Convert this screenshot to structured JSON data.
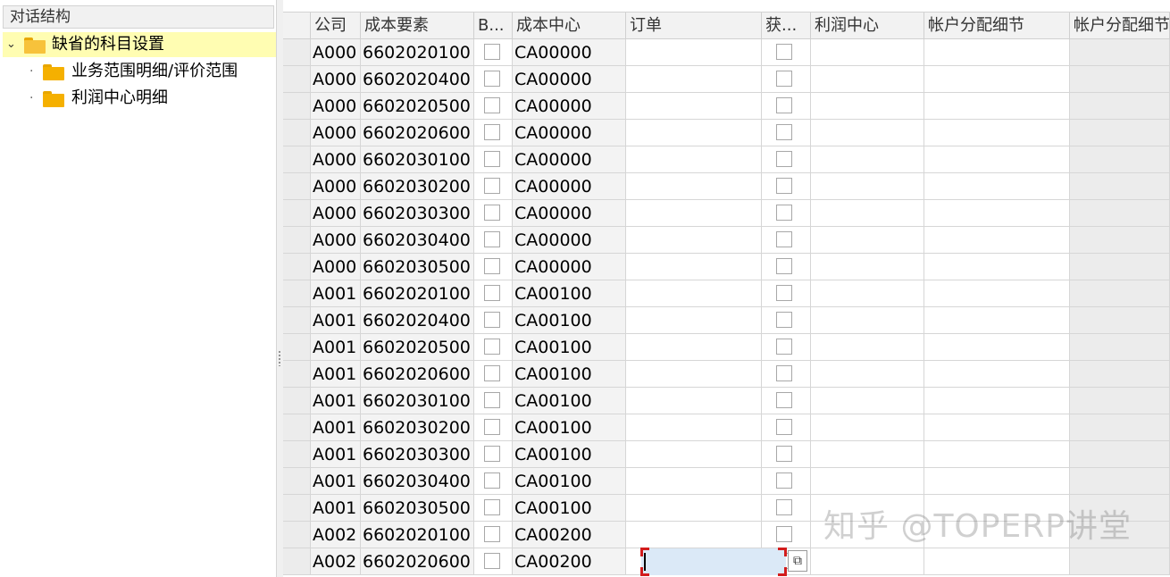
{
  "left_panel": {
    "title": "对话结构",
    "tree": {
      "root_label": "缺省的科目设置",
      "children": [
        "业务范围明细/评价范围",
        "利润中心明细"
      ]
    }
  },
  "grid": {
    "headers": [
      "公司",
      "成本要素",
      "B...",
      "成本中心",
      "订单",
      "获...",
      "利润中心",
      "帐户分配细节",
      "帐户分配细节"
    ],
    "rows": [
      {
        "company": "A000",
        "cost_element": "6602020100",
        "cost_center": "CA00000"
      },
      {
        "company": "A000",
        "cost_element": "6602020400",
        "cost_center": "CA00000"
      },
      {
        "company": "A000",
        "cost_element": "6602020500",
        "cost_center": "CA00000"
      },
      {
        "company": "A000",
        "cost_element": "6602020600",
        "cost_center": "CA00000"
      },
      {
        "company": "A000",
        "cost_element": "6602030100",
        "cost_center": "CA00000"
      },
      {
        "company": "A000",
        "cost_element": "6602030200",
        "cost_center": "CA00000"
      },
      {
        "company": "A000",
        "cost_element": "6602030300",
        "cost_center": "CA00000"
      },
      {
        "company": "A000",
        "cost_element": "6602030400",
        "cost_center": "CA00000"
      },
      {
        "company": "A000",
        "cost_element": "6602030500",
        "cost_center": "CA00000"
      },
      {
        "company": "A001",
        "cost_element": "6602020100",
        "cost_center": "CA00100"
      },
      {
        "company": "A001",
        "cost_element": "6602020400",
        "cost_center": "CA00100"
      },
      {
        "company": "A001",
        "cost_element": "6602020500",
        "cost_center": "CA00100"
      },
      {
        "company": "A001",
        "cost_element": "6602020600",
        "cost_center": "CA00100"
      },
      {
        "company": "A001",
        "cost_element": "6602030100",
        "cost_center": "CA00100"
      },
      {
        "company": "A001",
        "cost_element": "6602030200",
        "cost_center": "CA00100"
      },
      {
        "company": "A001",
        "cost_element": "6602030300",
        "cost_center": "CA00100"
      },
      {
        "company": "A001",
        "cost_element": "6602030400",
        "cost_center": "CA00100"
      },
      {
        "company": "A001",
        "cost_element": "6602030500",
        "cost_center": "CA00100"
      },
      {
        "company": "A002",
        "cost_element": "6602020100",
        "cost_center": "CA00200"
      },
      {
        "company": "A002",
        "cost_element": "6602020600",
        "cost_center": "CA00200"
      }
    ]
  },
  "icons": {
    "tree_expand": "chevron-down-icon",
    "folder": "folder-icon",
    "f4_help": "value-help-icon",
    "f4_glyph": "⧉"
  },
  "watermark": "知乎 @TOPERP讲堂"
}
